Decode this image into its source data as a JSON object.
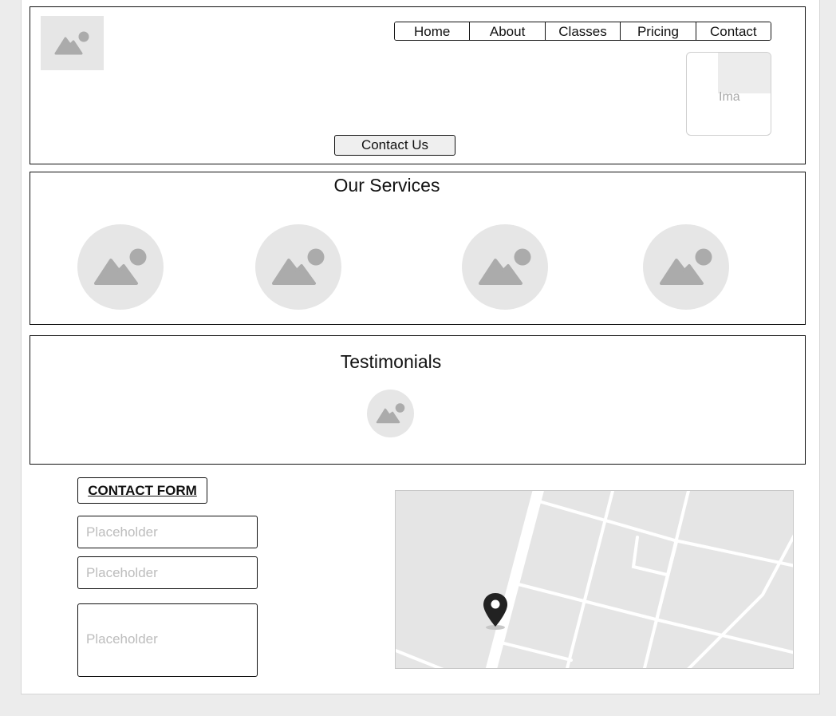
{
  "header": {
    "logo_icon": "image-placeholder-icon",
    "nav": [
      "Home",
      "About",
      "Classes",
      "Pricing",
      "Contact"
    ],
    "image_alt": "Ima",
    "cta_label": "Contact Us"
  },
  "services": {
    "title": "Our Services",
    "items_icon": "image-placeholder-icon"
  },
  "testimonials": {
    "title": "Testimonials"
  },
  "contact": {
    "form_title": "CONTACT FORM",
    "fields": [
      {
        "placeholder": "Placeholder"
      },
      {
        "placeholder": "Placeholder"
      },
      {
        "placeholder": "Placeholder"
      }
    ],
    "map_icon": "map-pin-icon"
  },
  "colors": {
    "page_bg": "#ececec",
    "placeholder_bg": "#e6e6e6",
    "placeholder_glyph": "#ababab"
  }
}
